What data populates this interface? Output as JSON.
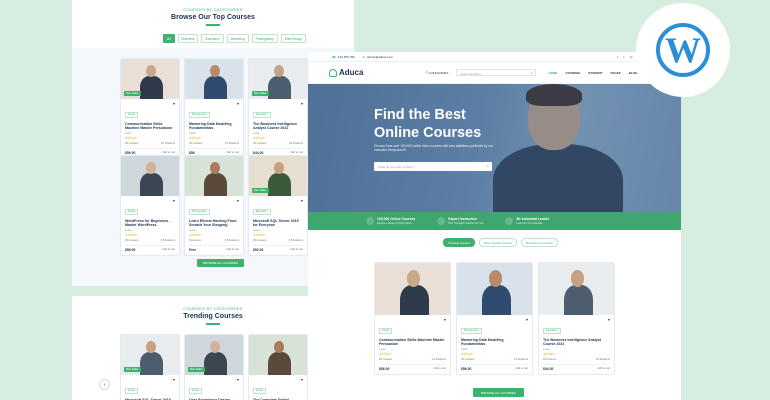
{
  "left_top": {
    "kicker": "COURSES BY CATEGORIES",
    "title": "Browse Our Top Courses",
    "chips": [
      "All",
      "Business",
      "Education",
      "Marketing",
      "Photography",
      "Web Design"
    ],
    "button": "BROWSE ALL COURSES"
  },
  "left_cards": [
    {
      "tag": "Social",
      "title": "Communication Skills Machine Master Persuasion",
      "author": "Lewis",
      "lessons": "28 Lessons",
      "students": "10 Students",
      "price": "$56.00",
      "cart": "Add to cart",
      "badge": "Best Seller"
    },
    {
      "tag": "Photography",
      "title": "Mastering Data Modeling Fundamentals",
      "author": "Jakob",
      "lessons": "18 Lessons",
      "students": "15 Students",
      "price": "$56",
      "cart": "Add to cart",
      "badge": ""
    },
    {
      "tag": "Education",
      "title": "The Business Intelligence Analyst Course 2021",
      "author": "Lewis",
      "lessons": "18 Lessons",
      "students": "18 Students",
      "price": "$44.00",
      "cart": "Add to cart",
      "badge": "Best Seller"
    },
    {
      "tag": "Social",
      "title": "WordPress for Beginners - Master WordPress",
      "author": "Lewis",
      "lessons": "18 Lessons",
      "students": "18 Students",
      "price": "$56.00",
      "cart": "Add to cart",
      "badge": ""
    },
    {
      "tag": "Photography",
      "title": "Learn Ethical Hacking From Scratch Your Stepping",
      "author": "Lewis",
      "lessons": "8 Lessons",
      "students": "18 Students",
      "price": "Free",
      "cart": "Add to cart",
      "badge": ""
    },
    {
      "tag": "Education",
      "title": "Microsoft SQL Server 2019 for Everyone",
      "author": "Lewis",
      "lessons": "18 Lessons",
      "students": "18 Students",
      "price": "$53.00",
      "cart": "Add to cart",
      "badge": "Best Seller"
    }
  ],
  "left_bottom": {
    "kicker": "COURSES BY CATEGORIES",
    "title": "Trending Courses",
    "cards": [
      {
        "tag": "Social",
        "title": "Microsoft SQL Server 2019 for Everyone",
        "badge": "Best Seller"
      },
      {
        "tag": "Social",
        "title": "User Experience Design - Adobe XD UI UX Design",
        "badge": "Best Seller"
      },
      {
        "tag": "Social",
        "title": "The Complete Digital Finance Marketing Course",
        "badge": ""
      }
    ]
  },
  "topbar": {
    "phone": "123 456 789",
    "email": "admin@aduca.com",
    "social": "f ✓ ◎ in",
    "login": "Login"
  },
  "navbar": {
    "logo": "Aduca",
    "category": "CATEGORIES",
    "search_placeholder": "Search anything",
    "menu": [
      "HOME",
      "COURSES",
      "STUDENT",
      "PAGES",
      "BLOG",
      "CONTACT"
    ]
  },
  "hero": {
    "title_line1": "Find the Best",
    "title_line2": "Online Courses",
    "subtitle": "Choose from over 100,000 online video courses with new additions published by our instructor every month",
    "search_placeholder": "What do you want to learn?"
  },
  "features": [
    {
      "title": "100,000 Online Courses",
      "sub": "Explore a Variety of Fresh Topics"
    },
    {
      "title": "Expert Instruction",
      "sub": "Find The Right Instructor For You"
    },
    {
      "title": "Be Industrial Leader",
      "sub": "Learn On Your Schedule"
    }
  ],
  "main_tabs": [
    "Trending Courses",
    "Most Popular Courses",
    "Most Recent Courses"
  ],
  "main_cards": [
    {
      "tag": "Social",
      "title": "Communication Skills Machine Master Persuasion",
      "author": "Lewis",
      "lessons": "28 Lessons",
      "students": "10 Students",
      "price": "$56.00",
      "cart": "Add to cart"
    },
    {
      "tag": "Photography",
      "title": "Mastering Data Modeling Fundamentals",
      "author": "Jakob",
      "lessons": "18 Lessons",
      "students": "15 Students",
      "price": "$56.00",
      "cart": "Add to cart"
    },
    {
      "tag": "Education",
      "title": "The Business Intelligence Analyst Course 2021",
      "author": "Lewis",
      "lessons": "18 Lessons",
      "students": "18 Students",
      "price": "$44.00",
      "cart": "Add to cart"
    }
  ],
  "main_button": "BROWSE ALL COURSES",
  "stars": "★★★★★",
  "colors": {
    "accent": "#3fb16e",
    "brand": "#2a8fd6",
    "background": "#d7ede0"
  },
  "wp_logo": "W"
}
